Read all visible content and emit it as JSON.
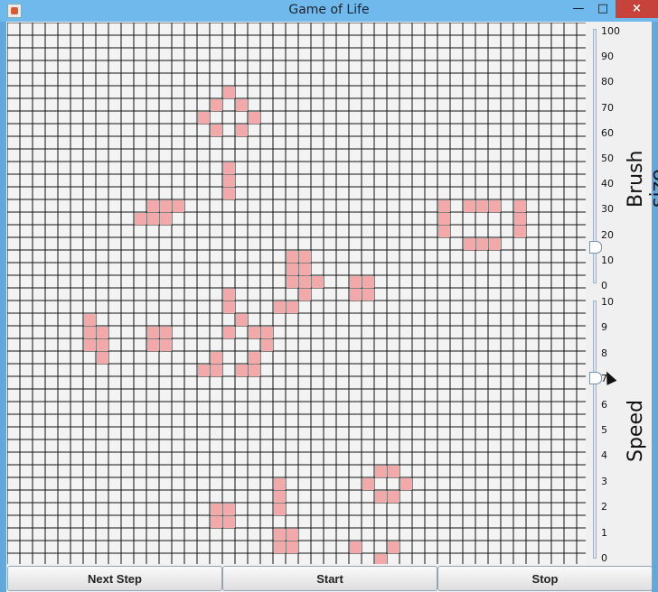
{
  "window": {
    "title": "Game of Life"
  },
  "controls": {
    "brush_label": "Brush size",
    "brush_ticks": [
      "100",
      "90",
      "80",
      "70",
      "60",
      "50",
      "40",
      "30",
      "20",
      "10",
      "0"
    ],
    "brush_value": 15,
    "speed_label": "Speed",
    "speed_ticks": [
      "10",
      "9",
      "8",
      "7",
      "6",
      "5",
      "4",
      "3",
      "2",
      "1",
      "0"
    ],
    "speed_value": 7
  },
  "buttons": {
    "next": "Next Step",
    "start": "Start",
    "stop": "Stop"
  },
  "grid": {
    "rows": 43,
    "cols": 46,
    "cells": [
      [
        5,
        17
      ],
      [
        6,
        16
      ],
      [
        6,
        18
      ],
      [
        7,
        15
      ],
      [
        7,
        19
      ],
      [
        8,
        16
      ],
      [
        8,
        18
      ],
      [
        11,
        17
      ],
      [
        12,
        17
      ],
      [
        13,
        17
      ],
      [
        14,
        36
      ],
      [
        14,
        37
      ],
      [
        14,
        38
      ],
      [
        14,
        13
      ],
      [
        14,
        12
      ],
      [
        14,
        11
      ],
      [
        15,
        10
      ],
      [
        15,
        11
      ],
      [
        15,
        12
      ],
      [
        14,
        34
      ],
      [
        15,
        34
      ],
      [
        16,
        34
      ],
      [
        14,
        40
      ],
      [
        15,
        40
      ],
      [
        16,
        40
      ],
      [
        17,
        36
      ],
      [
        17,
        37
      ],
      [
        17,
        38
      ],
      [
        18,
        22
      ],
      [
        18,
        23
      ],
      [
        19,
        22
      ],
      [
        19,
        23
      ],
      [
        20,
        22
      ],
      [
        20,
        23
      ],
      [
        20,
        24
      ],
      [
        21,
        23
      ],
      [
        20,
        27
      ],
      [
        20,
        28
      ],
      [
        21,
        27
      ],
      [
        21,
        28
      ],
      [
        21,
        17
      ],
      [
        22,
        17
      ],
      [
        22,
        21
      ],
      [
        22,
        22
      ],
      [
        23,
        6
      ],
      [
        24,
        6
      ],
      [
        24,
        7
      ],
      [
        25,
        6
      ],
      [
        25,
        7
      ],
      [
        26,
        7
      ],
      [
        24,
        11
      ],
      [
        24,
        12
      ],
      [
        25,
        11
      ],
      [
        25,
        12
      ],
      [
        23,
        18
      ],
      [
        24,
        17
      ],
      [
        24,
        19
      ],
      [
        24,
        20
      ],
      [
        25,
        20
      ],
      [
        26,
        19
      ],
      [
        26,
        16
      ],
      [
        27,
        15
      ],
      [
        27,
        16
      ],
      [
        27,
        18
      ],
      [
        27,
        19
      ],
      [
        35,
        29
      ],
      [
        35,
        30
      ],
      [
        36,
        28
      ],
      [
        36,
        31
      ],
      [
        37,
        29
      ],
      [
        37,
        30
      ],
      [
        36,
        21
      ],
      [
        37,
        21
      ],
      [
        38,
        21
      ],
      [
        38,
        16
      ],
      [
        38,
        17
      ],
      [
        39,
        16
      ],
      [
        39,
        17
      ],
      [
        40,
        21
      ],
      [
        40,
        22
      ],
      [
        41,
        21
      ],
      [
        41,
        22
      ],
      [
        41,
        27
      ],
      [
        41,
        30
      ],
      [
        42,
        29
      ],
      [
        43,
        26
      ],
      [
        43,
        27
      ]
    ]
  }
}
